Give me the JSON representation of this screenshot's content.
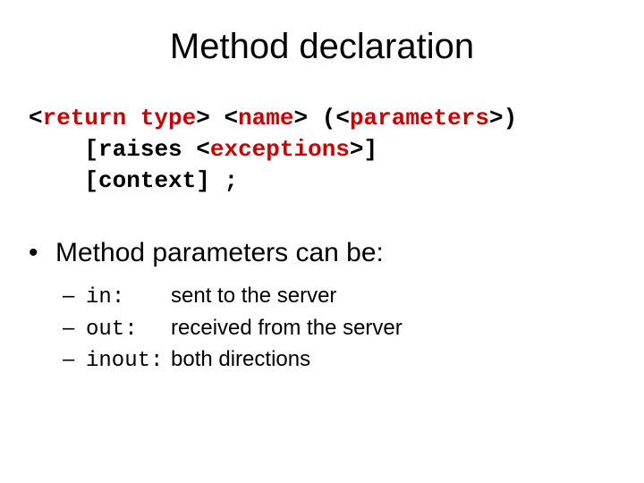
{
  "title": "Method declaration",
  "code": {
    "return_type": "return type",
    "name_kw": "name",
    "parameters_kw": "parameters",
    "raises_kw": "raises",
    "exceptions_kw": "exceptions",
    "context_kw": "context",
    "lt": "<",
    "gt": ">",
    "open_paren": "(",
    "close_paren": ")",
    "open_br": "[",
    "close_br": "]",
    "semicolon": ";",
    "sp": " "
  },
  "bullet": {
    "dot": "•",
    "text": "Method parameters can be:"
  },
  "params": [
    {
      "dash": "–",
      "name": "in",
      "colon": ":",
      "desc": "sent to the server"
    },
    {
      "dash": "–",
      "name": "out",
      "colon": ":",
      "desc": "received from the server"
    },
    {
      "dash": "–",
      "name": "inout",
      "colon": ":",
      "desc": "both directions"
    }
  ]
}
